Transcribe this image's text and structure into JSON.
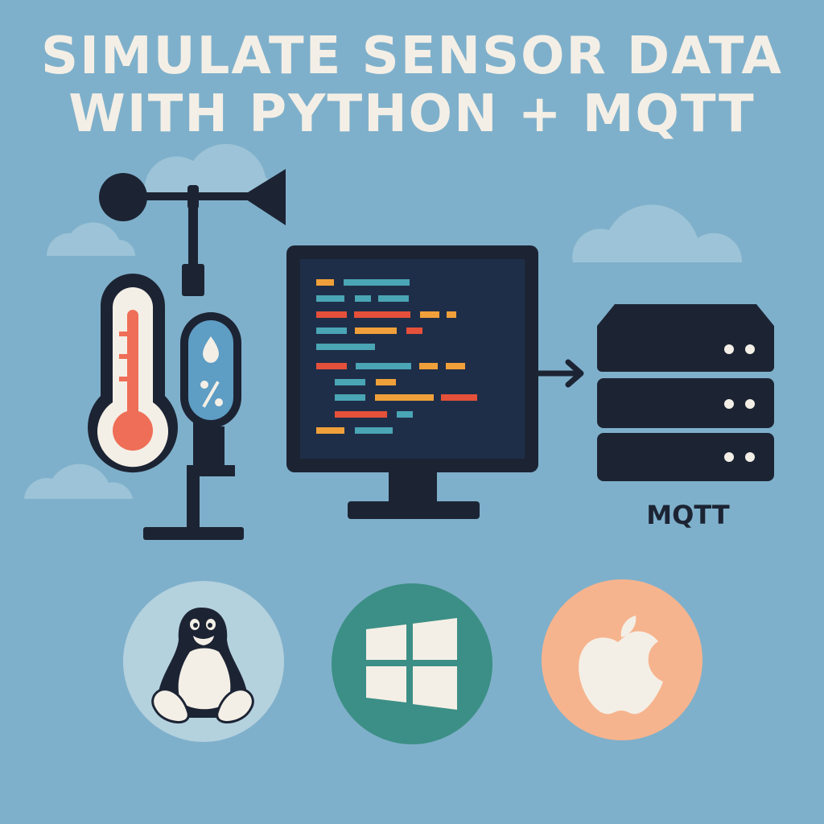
{
  "title": {
    "line1": "SIMULATE SENSOR DATA",
    "line2": "WITH PYTHON + MQTT"
  },
  "server": {
    "label": "MQTT"
  },
  "icons": {
    "weather_station": "anemometer-icon",
    "thermometer": "thermometer-icon",
    "humidity": "humidity-sensor-icon",
    "computer": "monitor-icon",
    "server": "server-stack-icon",
    "linux": "linux-penguin-icon",
    "windows": "windows-logo-icon",
    "apple": "apple-logo-icon"
  },
  "colors": {
    "background": "#7fb0cb",
    "cloud": "#9cc3d7",
    "title_text": "#f4efe6",
    "dark": "#1c2434",
    "screen": "#1f2e48",
    "thermo_red": "#ef6e57",
    "humidity_blue": "#5e9dc4",
    "linux_circle": "#b4d1de",
    "windows_circle": "#3c8f86",
    "apple_circle": "#f6b48e",
    "code_orange": "#f0a03a",
    "code_teal": "#4aa5b5",
    "code_red": "#e5503a"
  }
}
